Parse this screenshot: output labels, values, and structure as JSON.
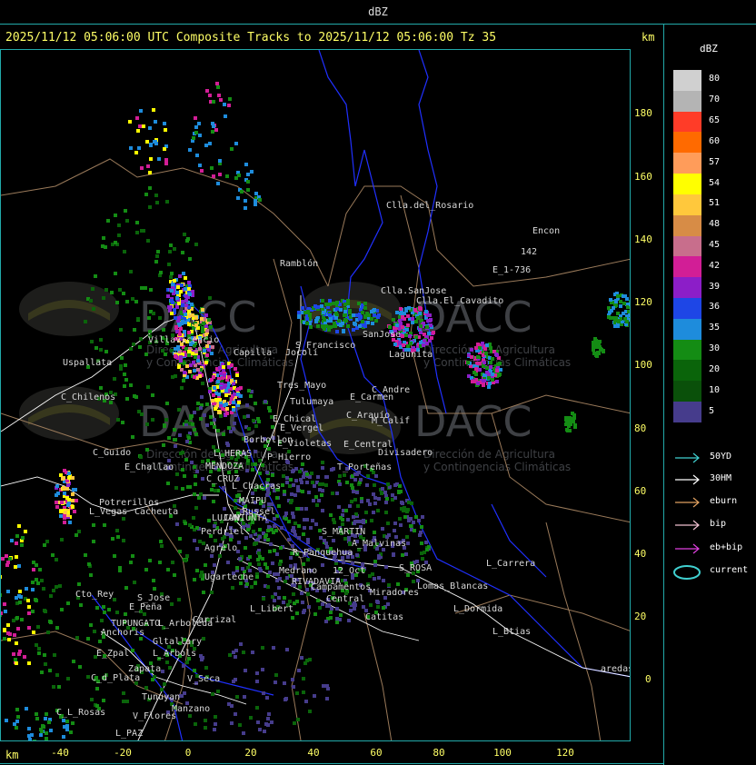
{
  "window": {
    "title": "dBZ"
  },
  "header": {
    "text": "2025/11/12 05:06:00 UTC Composite Tracks to 2025/11/12 05:06:00 Tz 35",
    "km_label": "km"
  },
  "axes": {
    "x_unit": "km",
    "y_unit": "km",
    "x_ticks": [
      "-40",
      "-20",
      "0",
      "20",
      "40",
      "60",
      "80",
      "100",
      "120"
    ],
    "y_ticks": [
      "180",
      "160",
      "140",
      "120",
      "100",
      "80",
      "60",
      "40",
      "20",
      "0"
    ]
  },
  "legend": {
    "title": "dBZ",
    "levels": [
      {
        "label": "80",
        "color": "#d0d0d0"
      },
      {
        "label": "70",
        "color": "#b4b4b4"
      },
      {
        "label": "65",
        "color": "#ff3c28"
      },
      {
        "label": "60",
        "color": "#ff6a00"
      },
      {
        "label": "57",
        "color": "#ff9c5a"
      },
      {
        "label": "54",
        "color": "#ffff00"
      },
      {
        "label": "51",
        "color": "#ffc83c"
      },
      {
        "label": "48",
        "color": "#d78c46"
      },
      {
        "label": "45",
        "color": "#c86e8c"
      },
      {
        "label": "42",
        "color": "#d21e96"
      },
      {
        "label": "39",
        "color": "#8c1ec8"
      },
      {
        "label": "36",
        "color": "#1e46e6"
      },
      {
        "label": "35",
        "color": "#1e8cdc"
      },
      {
        "label": "30",
        "color": "#148c14"
      },
      {
        "label": "20",
        "color": "#0a640a"
      },
      {
        "label": "10",
        "color": "#0a500a"
      },
      {
        "label": "5",
        "color": "#463c8c"
      }
    ],
    "tracks": [
      {
        "label": "50YD",
        "color": "#40d0d0"
      },
      {
        "label": "30HM",
        "color": "#ffffff"
      },
      {
        "label": "eburn",
        "color": "#e0a060"
      },
      {
        "label": "bip",
        "color": "#f0c0d0"
      },
      {
        "label": "eb+bip",
        "color": "#e040e0"
      },
      {
        "label": "current",
        "color": "#40d0d0"
      }
    ]
  },
  "watermark": {
    "brand": "DACC",
    "line1": "Dirección de Agricultura",
    "line2": "y Contingencias Climáticas"
  },
  "places": [
    "Clla.del_Rosario",
    "Encon",
    "Ramblón",
    "E_1-736",
    "142",
    "Clla.SanJose",
    "Clla.El_Cavadito",
    "Villavicencio",
    "Uspallata",
    "S_Francisco",
    "SanJose",
    "Lagunita",
    "Jocolí",
    "C_Andre",
    "Capilla",
    "Tres_Mayo",
    "Tulumaya",
    "E_Carmen",
    "C_Chilenos",
    "E_Chical",
    "C_Arauío",
    "E_Vergel",
    "M_Calif",
    "Borbollon",
    "E_Violetas",
    "E_Central",
    "Divisadero",
    "C_Guido",
    "L_HERAS",
    "P_Hierro",
    "E_Challao",
    "MENDOZA",
    "T_Porteñas",
    "C_CRUZ",
    "L_Chacras",
    "Potrerillos",
    "L_Vegas",
    "Cacheuta",
    "MAIPU",
    "Russel",
    "LUJAN",
    "CUNIUNTA",
    "Perdriel",
    "Agrelo",
    "S_MARTIN",
    "A_Malvinas",
    "R_Panquehua",
    "Ugarteche",
    "Medrano",
    "RIVADAVIA",
    "12_Oct",
    "S_ROSA",
    "Lomas_Blancas",
    "L_Carrera",
    "Cto_Rey",
    "S_Jose",
    "E_Peña",
    "TUPUNGATO",
    "Anchoris",
    "Carrizal",
    "L_Libert",
    "Campamentos",
    "Central",
    "Miradores",
    "Catitas",
    "L_Dormida",
    "L_Btias",
    "L_Arboleda",
    "Gltallary",
    "E_Zpal",
    "L_Arbols",
    "C_d_Plata",
    "Zapata",
    "V_Seca",
    "Tunuyan",
    "Manzano",
    "C_L_Rosas",
    "V_Flores",
    "L_PAZ",
    "aredas"
  ]
}
